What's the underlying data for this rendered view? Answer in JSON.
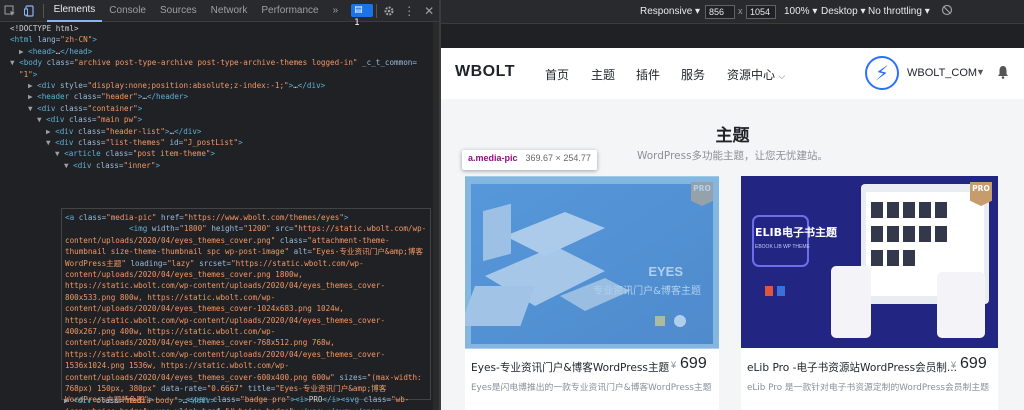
{
  "devtools": {
    "tabs": [
      "Elements",
      "Console",
      "Sources",
      "Network",
      "Performance"
    ],
    "more": "»",
    "issues_count": "1",
    "icons": [
      "inspect-icon",
      "device-toggle-icon",
      "gear-icon",
      "kebab-icon",
      "close-icon"
    ],
    "dom_lines": [
      {
        "indent": 0,
        "tri": "",
        "parts": [
          [
            "txt",
            "<!DOCTYPE html>"
          ]
        ]
      },
      {
        "indent": 0,
        "tri": "",
        "parts": [
          [
            "tag",
            "<html "
          ],
          [
            "attr",
            "lang="
          ],
          [
            "val",
            "\"zh-CN\""
          ],
          [
            "tag",
            ">"
          ]
        ]
      },
      {
        "indent": 1,
        "tri": "▶",
        "parts": [
          [
            "tag",
            "<head>"
          ],
          [
            "txt",
            "…"
          ],
          [
            "tag",
            "</head>"
          ]
        ]
      },
      {
        "indent": 0,
        "tri": "▼",
        "parts": [
          [
            "tag",
            "<body "
          ],
          [
            "attr",
            "class="
          ],
          [
            "val",
            "\"archive post-type-archive post-type-archive-themes logged-in\""
          ],
          [
            "attr",
            " _c_t_common="
          ]
        ]
      },
      {
        "indent": 1,
        "tri": "",
        "parts": [
          [
            "val",
            "\"1\""
          ],
          [
            "tag",
            ">"
          ]
        ]
      },
      {
        "indent": 2,
        "tri": "▶",
        "parts": [
          [
            "tag",
            "<div "
          ],
          [
            "attr",
            "style="
          ],
          [
            "val",
            "\"display:none;position:absolute;z-index:-1;\""
          ],
          [
            "tag",
            ">"
          ],
          [
            "txt",
            "…"
          ],
          [
            "tag",
            "</div>"
          ]
        ]
      },
      {
        "indent": 2,
        "tri": "▶",
        "parts": [
          [
            "tag",
            "<header "
          ],
          [
            "attr",
            "class="
          ],
          [
            "val",
            "\"header\""
          ],
          [
            "tag",
            ">"
          ],
          [
            "txt",
            "…"
          ],
          [
            "tag",
            "</header>"
          ]
        ]
      },
      {
        "indent": 2,
        "tri": "▼",
        "parts": [
          [
            "tag",
            "<div "
          ],
          [
            "attr",
            "class="
          ],
          [
            "val",
            "\"container\""
          ],
          [
            "tag",
            ">"
          ]
        ]
      },
      {
        "indent": 3,
        "tri": "▼",
        "parts": [
          [
            "tag",
            "<div "
          ],
          [
            "attr",
            "class="
          ],
          [
            "val",
            "\"main pw\""
          ],
          [
            "tag",
            ">"
          ]
        ]
      },
      {
        "indent": 4,
        "tri": "▶",
        "parts": [
          [
            "tag",
            "<div "
          ],
          [
            "attr",
            "class="
          ],
          [
            "val",
            "\"header-list\""
          ],
          [
            "tag",
            ">"
          ],
          [
            "txt",
            "…"
          ],
          [
            "tag",
            "</div>"
          ]
        ]
      },
      {
        "indent": 4,
        "tri": "▼",
        "parts": [
          [
            "tag",
            "<div "
          ],
          [
            "attr",
            "class="
          ],
          [
            "val",
            "\"list-themes\""
          ],
          [
            "attr",
            " id="
          ],
          [
            "val",
            "\"J_postList\""
          ],
          [
            "tag",
            ">"
          ]
        ]
      },
      {
        "indent": 5,
        "tri": "▼",
        "parts": [
          [
            "tag",
            "<article "
          ],
          [
            "attr",
            "class="
          ],
          [
            "val",
            "\"post item-theme\""
          ],
          [
            "tag",
            ">"
          ]
        ]
      },
      {
        "indent": 6,
        "tri": "▼",
        "parts": [
          [
            "tag",
            "<div "
          ],
          [
            "attr",
            "class="
          ],
          [
            "val",
            "\"inner\""
          ],
          [
            "tag",
            ">"
          ]
        ]
      }
    ],
    "selected_lines": [
      [
        [
          "tag",
          "<a "
        ],
        [
          "attr",
          "class="
        ],
        [
          "val",
          "\"media-pic\""
        ],
        [
          "attr",
          " href="
        ],
        [
          "val",
          "\"https://www.wbolt.com/themes/eyes\""
        ],
        [
          "tag",
          ">"
        ]
      ],
      [
        [
          "txt",
          "              "
        ],
        [
          "tag",
          "<img "
        ],
        [
          "attr",
          "width="
        ],
        [
          "val",
          "\"1800\""
        ],
        [
          "attr",
          " height="
        ],
        [
          "val",
          "\"1200\""
        ],
        [
          "attr",
          " src="
        ],
        [
          "val",
          "\"https://static.wbolt.com/wp-"
        ]
      ],
      [
        [
          "val",
          "content/uploads/2020/04/eyes_themes_cover.png\""
        ],
        [
          "attr",
          " class="
        ],
        [
          "val",
          "\"attachment-theme-"
        ]
      ],
      [
        [
          "val",
          "thumbnail size-theme-thumbnail spc wp-post-image\""
        ],
        [
          "attr",
          " alt="
        ],
        [
          "val",
          "\"Eyes-专业资讯门户&amp;博客"
        ]
      ],
      [
        [
          "val",
          "WordPress主题\""
        ],
        [
          "attr",
          " loading="
        ],
        [
          "val",
          "\"lazy\""
        ],
        [
          "attr",
          " srcset="
        ],
        [
          "val",
          "\"https://static.wbolt.com/wp-"
        ]
      ],
      [
        [
          "val",
          "content/uploads/2020/04/eyes_themes_cover.png 1800w,"
        ]
      ],
      [
        [
          "val",
          "https://static.wbolt.com/wp-content/uploads/2020/04/eyes_themes_cover-"
        ]
      ],
      [
        [
          "val",
          "800x533.png 800w, https://static.wbolt.com/wp-"
        ]
      ],
      [
        [
          "val",
          "content/uploads/2020/04/eyes_themes_cover-1024x683.png 1024w,"
        ]
      ],
      [
        [
          "val",
          "https://static.wbolt.com/wp-content/uploads/2020/04/eyes_themes_cover-"
        ]
      ],
      [
        [
          "val",
          "400x267.png 400w, https://static.wbolt.com/wp-"
        ]
      ],
      [
        [
          "val",
          "content/uploads/2020/04/eyes_themes_cover-768x512.png 768w,"
        ]
      ],
      [
        [
          "val",
          "https://static.wbolt.com/wp-content/uploads/2020/04/eyes_themes_cover-"
        ]
      ],
      [
        [
          "val",
          "1536x1024.png 1536w, https://static.wbolt.com/wp-"
        ]
      ],
      [
        [
          "val",
          "content/uploads/2020/04/eyes_themes_cover-600x400.png 600w\""
        ],
        [
          "attr",
          " sizes="
        ],
        [
          "val",
          "\"(max-width:"
        ]
      ],
      [
        [
          "val",
          "768px) 150px, 380px\""
        ],
        [
          "attr",
          " data-rate="
        ],
        [
          "val",
          "\"0.6667\""
        ],
        [
          "attr",
          " title="
        ],
        [
          "val",
          "\"Eyes-专业资讯门户&amp;博客"
        ]
      ],
      [
        [
          "val",
          "WordPress主题特色图\""
        ],
        [
          "tag",
          ">"
        ],
        [
          "txt",
          "       "
        ],
        [
          "tag",
          "<span "
        ],
        [
          "attr",
          "class="
        ],
        [
          "val",
          "\"badge pro\""
        ],
        [
          "tag",
          "><i>"
        ],
        [
          "txt",
          "PRO"
        ],
        [
          "tag",
          "</i><svg "
        ],
        [
          "attr",
          "class="
        ],
        [
          "val",
          "\"wb-"
        ]
      ],
      [
        [
          "val",
          "icon wbsico-badge\""
        ],
        [
          "tag",
          "><use "
        ],
        [
          "attr",
          "xlink:href="
        ],
        [
          "val",
          "\"#wbsico-badge\""
        ],
        [
          "tag",
          "></use></svg></span>"
        ]
      ],
      [
        [
          "tag",
          "</a>"
        ]
      ]
    ],
    "after_line": [
      [
        "tag",
        "<div "
      ],
      [
        "attr",
        "class="
      ],
      [
        "val",
        "\"media-body\""
      ],
      [
        "tag",
        ">"
      ],
      [
        "txt",
        "…"
      ],
      [
        "tag",
        "</div>"
      ]
    ]
  },
  "emulation": {
    "device": "Responsive",
    "width": "856",
    "times": "x",
    "height": "1054",
    "zoom": "100%",
    "mode": "Desktop",
    "throttle": "No throttling"
  },
  "site": {
    "logo": "WBOLT",
    "nav": [
      "首页",
      "主题",
      "插件",
      "服务",
      "资源中心"
    ],
    "username": "WBOLT_COM",
    "title": "主题",
    "subtitle": "WordPress多功能主题，让您无忧建站。",
    "tooltip_selector": "a.media-pic",
    "tooltip_size": "369.67 × 254.77",
    "cards": [
      {
        "title": "Eyes-专业资讯门户&博客WordPress主题",
        "price": "699",
        "yen": "¥",
        "desc": "Eyes是闪电博推出的一款专业资讯门户&博客WordPress主题",
        "badge": "PRO",
        "cover_title": "EYES",
        "cover_sub": "专业资讯门户&博客主题"
      },
      {
        "title": "eLib Pro -电子书资源站WordPress会员制...",
        "price": "699",
        "yen": "¥",
        "desc": "eLib Pro 是一款针对电子书资源定制的WordPress会员制主题",
        "badge": "PRO",
        "cover_title": "ELIB电子书主题",
        "cover_sub": "EBOOK LIB WP THEME"
      }
    ]
  }
}
